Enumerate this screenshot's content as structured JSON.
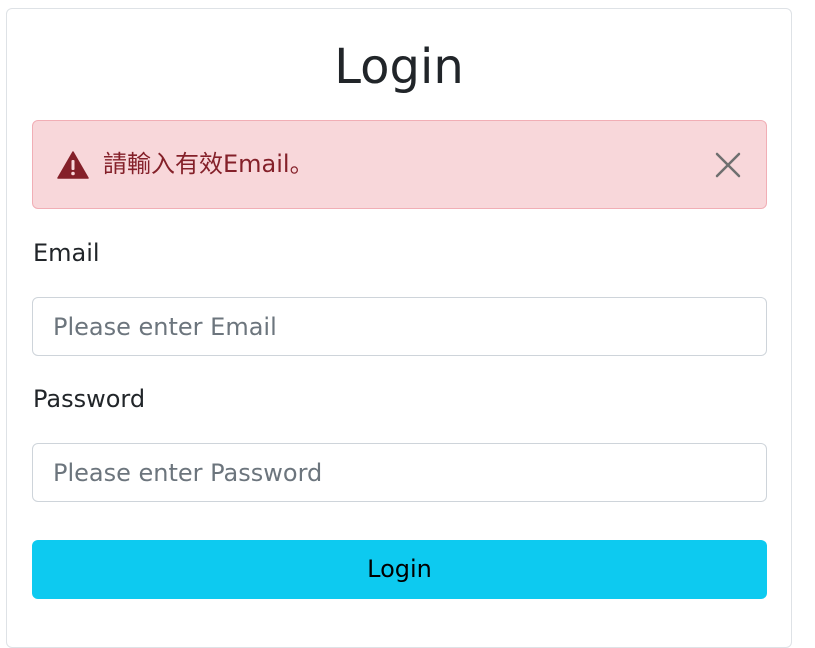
{
  "page": {
    "title": "Login"
  },
  "alert": {
    "icon": "warning-triangle-icon",
    "message": "請輸入有效Email。",
    "close_icon": "close-icon",
    "colors": {
      "background": "#f8d7da",
      "border": "#f1aeb5",
      "text": "#842029"
    }
  },
  "form": {
    "email": {
      "label": "Email",
      "placeholder": "Please enter Email",
      "value": ""
    },
    "password": {
      "label": "Password",
      "placeholder": "Please enter Password",
      "value": ""
    },
    "submit_label": "Login",
    "submit_color": "#0dcaf0"
  }
}
